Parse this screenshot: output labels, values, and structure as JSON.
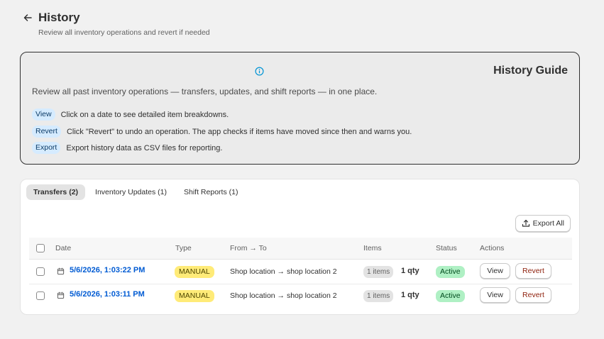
{
  "header": {
    "title": "History",
    "subtitle": "Review all inventory operations and revert if needed"
  },
  "guide": {
    "title": "History Guide",
    "description": "Review all past inventory operations — transfers, updates, and shift reports — in one place.",
    "rows": [
      {
        "pill": "View",
        "text": "Click on a date to see detailed item breakdowns."
      },
      {
        "pill": "Revert",
        "text": "Click \"Revert\" to undo an operation. The app checks if items have moved since then and warns you."
      },
      {
        "pill": "Export",
        "text": "Export history data as CSV files for reporting."
      }
    ]
  },
  "tabs": [
    {
      "label": "Transfers (2)",
      "active": true
    },
    {
      "label": "Inventory Updates (1)",
      "active": false
    },
    {
      "label": "Shift Reports (1)",
      "active": false
    }
  ],
  "toolbar": {
    "export_label": "Export All"
  },
  "table": {
    "columns": {
      "date": "Date",
      "type": "Type",
      "route": "From → To",
      "items": "Items",
      "status": "Status",
      "actions": "Actions"
    },
    "rows": [
      {
        "date": "5/6/2026, 1:03:22 PM",
        "type": "MANUAL",
        "route": "Shop location → shop location 2",
        "items": "1 items",
        "qty": "1 qty",
        "status": "Active",
        "view_label": "View",
        "revert_label": "Revert"
      },
      {
        "date": "5/6/2026, 1:03:11 PM",
        "type": "MANUAL",
        "route": "Shop location → shop location 2",
        "items": "1 items",
        "qty": "1 qty",
        "status": "Active",
        "view_label": "View",
        "revert_label": "Revert"
      }
    ]
  },
  "colors": {
    "accent_link": "#005bd3",
    "info_icon": "#0094d5",
    "type_badge": "#ffeb78",
    "status_badge": "#aff0c4",
    "revert_text": "#8e1f0b"
  },
  "icons": {
    "back": "arrow-left-icon",
    "info": "info-icon",
    "export": "upload-icon",
    "date": "calendar-icon"
  }
}
